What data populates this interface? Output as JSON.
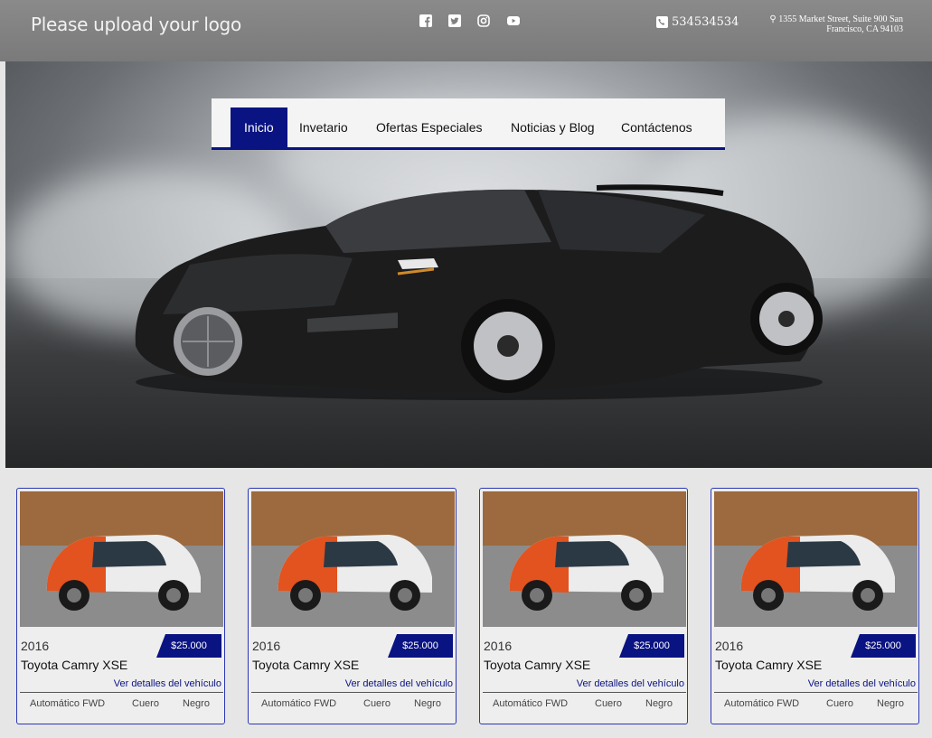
{
  "header": {
    "logo_text": "Please upload your logo",
    "social": [
      "facebook-icon",
      "twitter-icon",
      "instagram-icon",
      "youtube-icon"
    ],
    "phone": "534534534",
    "address_line1": "1355 Market Street, Suite 900 San",
    "address_line2": "Francisco, CA 94103"
  },
  "nav": {
    "items": [
      {
        "label": "Inicio",
        "active": true
      },
      {
        "label": "Invetario"
      },
      {
        "label": "Ofertas Especiales"
      },
      {
        "label": "Noticias y Blog"
      },
      {
        "label": "Contáctenos"
      }
    ]
  },
  "listings": [
    {
      "year": "2016",
      "model": "Toyota Camry XSE",
      "price": "$25.000",
      "details_link": "Ver detalles del vehículo",
      "transmission": "Automático FWD",
      "interior": "Cuero",
      "color": "Negro"
    },
    {
      "year": "2016",
      "model": "Toyota Camry XSE",
      "price": "$25.000",
      "details_link": "Ver detalles del vehículo",
      "transmission": "Automático FWD",
      "interior": "Cuero",
      "color": "Negro"
    },
    {
      "year": "2016",
      "model": "Toyota Camry XSE",
      "price": "$25.000",
      "details_link": "Ver detalles del vehículo",
      "transmission": "Automático FWD",
      "interior": "Cuero",
      "color": "Negro"
    },
    {
      "year": "2016",
      "model": "Toyota Camry XSE",
      "price": "$25.000",
      "details_link": "Ver detalles del vehículo",
      "transmission": "Automático FWD",
      "interior": "Cuero",
      "color": "Negro"
    }
  ],
  "colors": {
    "accent": "#0a1382",
    "header_bg": "#808080"
  }
}
